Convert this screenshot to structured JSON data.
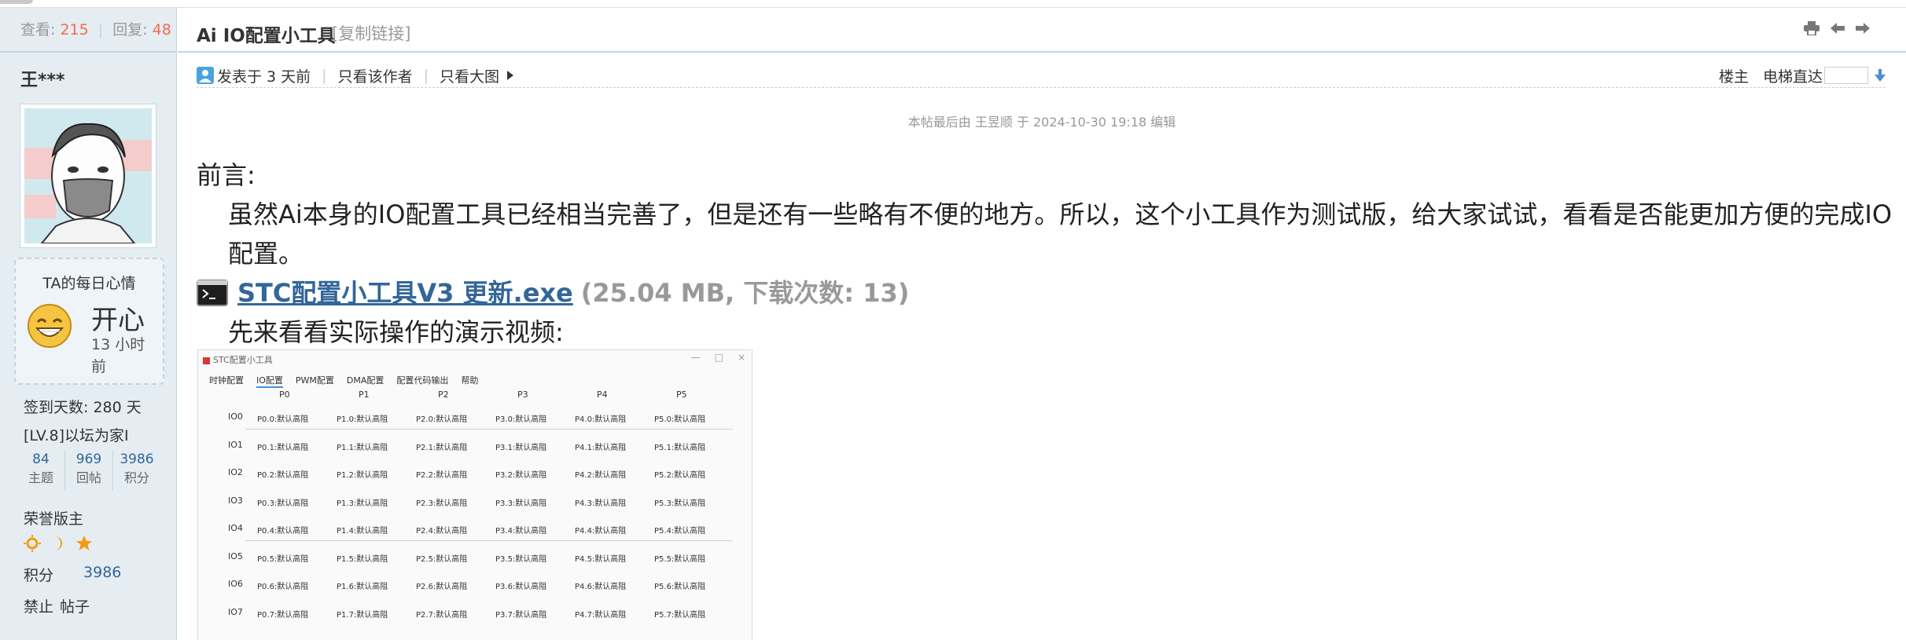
{
  "sidebar": {
    "views_label": "查看:",
    "views": "215",
    "replies_label": "回复:",
    "replies": "48",
    "author_name": "王***",
    "mood_title": "TA的每日心情",
    "mood_word": "开心",
    "mood_time": "13 小时前",
    "signin": "签到天数: 280 天",
    "level": "[LV.8]以坛为家I",
    "counts": [
      {
        "value": "84",
        "label": "主题"
      },
      {
        "value": "969",
        "label": "回帖"
      },
      {
        "value": "3986",
        "label": "积分"
      }
    ],
    "honor": "荣誉版主",
    "score_label": "积分",
    "score_value": "3986",
    "ban": "禁止",
    "posts": "帖子"
  },
  "thread": {
    "title": "Ai IO配置小工具",
    "copy_link": "[复制链接]"
  },
  "postinfo": {
    "posted": "发表于 3 天前",
    "only_author": "只看该作者",
    "big_image": "只看大图",
    "owner": "楼主",
    "elevator": "电梯直达"
  },
  "post": {
    "edited": "本帖最后由 王昱顺 于 2024-10-30 19:18 编辑",
    "heading": "前言:",
    "paragraph": "虽然Ai本身的IO配置工具已经相当完善了，但是还有一些略有不便的地方。所以，这个小工具作为测试版，给大家试试，看看是否能更加方便的完成IO配置。",
    "attachment_name": "STC配置小工具V3 更新.exe",
    "attachment_meta": "(25.04 MB, 下载次数: 13)",
    "demo_text": "先来看看实际操作的演示视频:"
  },
  "screenshot": {
    "window_title": "STC配置小工具",
    "window_buttons": [
      "—",
      "□",
      "×"
    ],
    "tabs": [
      "时钟配置",
      "IO配置",
      "PWM配置",
      "DMA配置",
      "配置代码输出",
      "帮助"
    ],
    "active_tab": "IO配置",
    "columns": [
      "P0",
      "P1",
      "P2",
      "P3",
      "P4",
      "P5"
    ],
    "rows": [
      "IO0",
      "IO1",
      "IO2",
      "IO3",
      "IO4",
      "IO5",
      "IO6",
      "IO7"
    ],
    "cell_suffix": ":默认高阻"
  },
  "colors": {
    "sidebar_bg": "#e5edf2",
    "border": "#c2d5e3",
    "link": "#336699",
    "accent": "#f26c4f"
  },
  "icons": {
    "print": "print-icon",
    "prev": "arrow-left-icon",
    "next": "arrow-right-icon",
    "user": "user-icon",
    "triangle": "triangle-right-icon",
    "download": "down-arrow-icon",
    "exe": "terminal-icon",
    "sun": "sun-icon",
    "moon": "moon-icon",
    "star": "star-icon"
  }
}
